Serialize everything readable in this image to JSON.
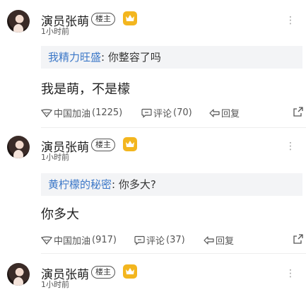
{
  "comments": [
    {
      "author": "演员张萌",
      "host_badge": "楼主",
      "time": "1小时前",
      "quote_name": "我精力旺盛",
      "quote_sep": ": ",
      "quote_text": "你整容了吗",
      "content": "我是萌，不是檬",
      "like_label": "中国加油",
      "like_count": "(1225)",
      "comment_label": "评论",
      "comment_count": "(70)",
      "reply_label": "回复"
    },
    {
      "author": "演员张萌",
      "host_badge": "楼主",
      "time": "1小时前",
      "quote_name": "黄柠檬的秘密",
      "quote_sep": ": ",
      "quote_text": "你多大?",
      "content": "你多大",
      "like_label": "中国加油",
      "like_count": "(917)",
      "comment_label": "评论",
      "comment_count": "(37)",
      "reply_label": "回复"
    },
    {
      "author": "演员张萌",
      "host_badge": "楼主",
      "time": "1小时前"
    }
  ],
  "icons": {
    "more": "more-vertical-icon",
    "crown": "crown-icon",
    "like": "like-icon",
    "comment": "comment-icon",
    "reply": "reply-icon",
    "share": "share-icon"
  },
  "colors": {
    "quote_name": "#3c78c8",
    "crown_badge": "#f3b61f",
    "quote_bg": "#f3f4f6"
  }
}
